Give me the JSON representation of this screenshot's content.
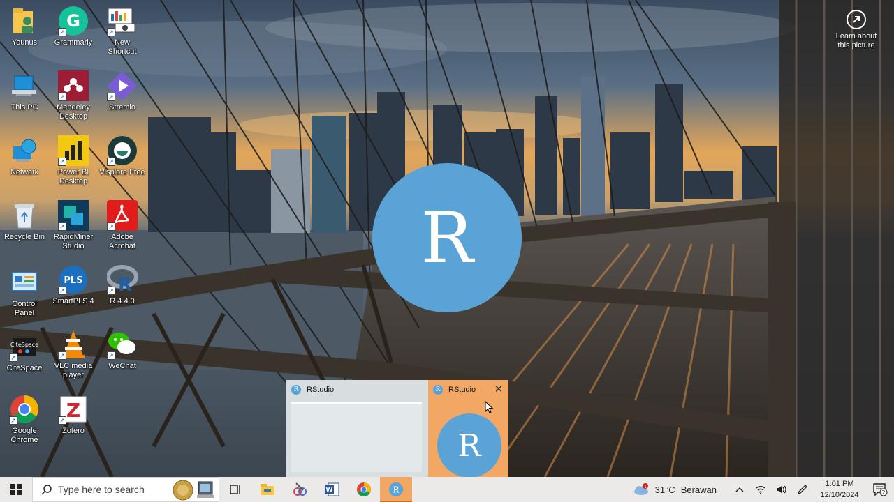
{
  "desktop": {
    "icons": [
      {
        "label": "Younus",
        "icon": "user-folder-icon"
      },
      {
        "label": "Grammarly",
        "icon": "grammarly-icon"
      },
      {
        "label": "New\nShortcut",
        "icon": "new-shortcut-icon"
      },
      {
        "label": "This PC",
        "icon": "this-pc-icon"
      },
      {
        "label": "Mendeley\nDesktop",
        "icon": "mendeley-icon"
      },
      {
        "label": "Stremio",
        "icon": "stremio-icon"
      },
      {
        "label": "Network",
        "icon": "network-icon"
      },
      {
        "label": "Power BI\nDesktop",
        "icon": "powerbi-icon"
      },
      {
        "label": "Visplore Free",
        "icon": "visplore-icon"
      },
      {
        "label": "Recycle Bin",
        "icon": "recycle-bin-icon"
      },
      {
        "label": "RapidMiner\nStudio",
        "icon": "rapidminer-icon"
      },
      {
        "label": "Adobe\nAcrobat",
        "icon": "acrobat-icon"
      },
      {
        "label": "Control\nPanel",
        "icon": "control-panel-icon"
      },
      {
        "label": "SmartPLS 4",
        "icon": "smartpls-icon"
      },
      {
        "label": "R 4.4.0",
        "icon": "r-icon"
      },
      {
        "label": "CiteSpace",
        "icon": "citespace-icon"
      },
      {
        "label": "VLC media\nplayer",
        "icon": "vlc-icon"
      },
      {
        "label": "WeChat",
        "icon": "wechat-icon"
      },
      {
        "label": "Google\nChrome",
        "icon": "chrome-icon"
      },
      {
        "label": "Zotero",
        "icon": "zotero-icon"
      }
    ],
    "learn_about": "Learn about\nthis picture",
    "splash_letter": "R"
  },
  "thumbnails": [
    {
      "title": "RStudio",
      "letter": "R"
    },
    {
      "title": "RStudio",
      "letter": "R",
      "close": "✕"
    }
  ],
  "taskbar": {
    "search_placeholder": "Type here to search",
    "weather": {
      "temp": "31°C",
      "condition": "Berawan",
      "badge": "1"
    },
    "time": "1:01 PM",
    "date": "12/10/2024",
    "notification_count": "2",
    "colors": {
      "active": "#f2a864",
      "r_blue": "#5aa3d6"
    }
  }
}
